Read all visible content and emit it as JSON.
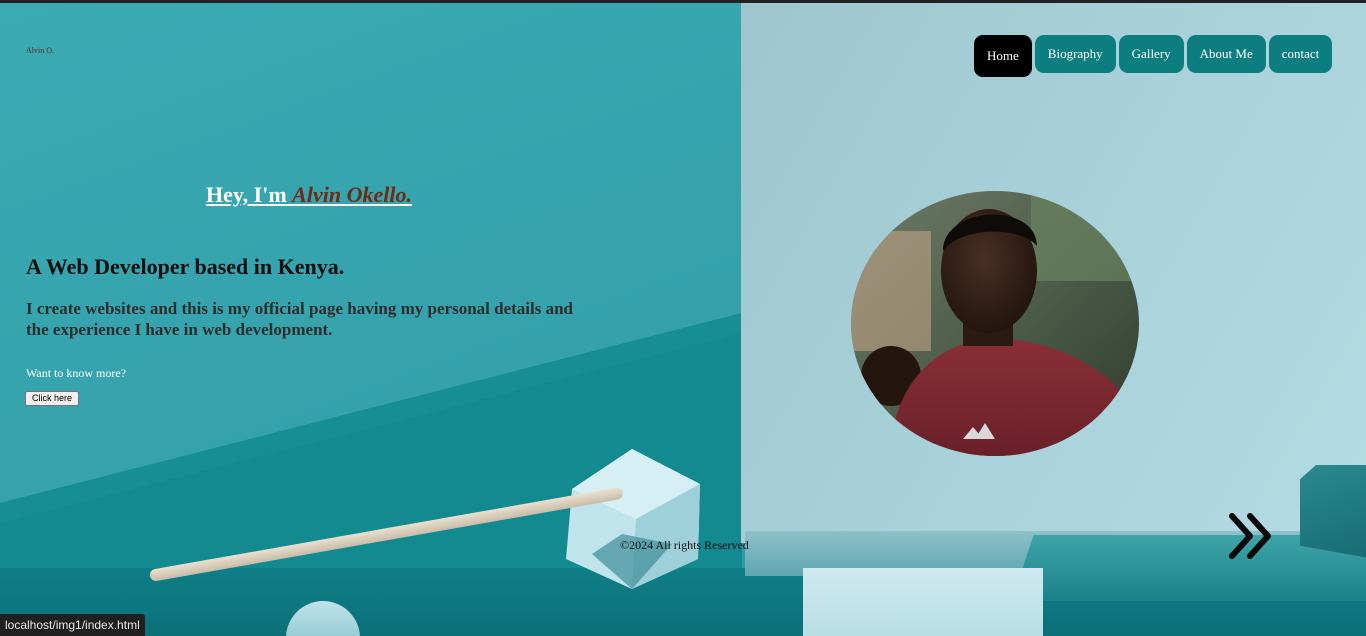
{
  "brand": {
    "text": "Alvin O."
  },
  "nav": {
    "items": [
      {
        "label": "Home",
        "active": true
      },
      {
        "label": "Biography"
      },
      {
        "label": "Gallery"
      },
      {
        "label": "About Me"
      },
      {
        "label": "contact"
      }
    ]
  },
  "hero": {
    "greeting": "Hey, I'm ",
    "name": "Alvin Okello.",
    "headline": "A Web Developer based in Kenya.",
    "description": "I create websites and this is my official page having my personal details and the experience I have in web development.",
    "prompt": "Want to know more?",
    "button_label": "Click here"
  },
  "profile": {
    "icon": "profile-photo"
  },
  "footer": {
    "copyright": "©2024 All rights Reserved"
  },
  "next_icon": "double-chevron-right-icon",
  "status_bar": {
    "url": "localhost/img1/index.html"
  },
  "colors": {
    "nav_bg": "#0c7e80",
    "nav_active": "#000000",
    "name": "#6e2a14",
    "teal": "#36a5ae"
  }
}
